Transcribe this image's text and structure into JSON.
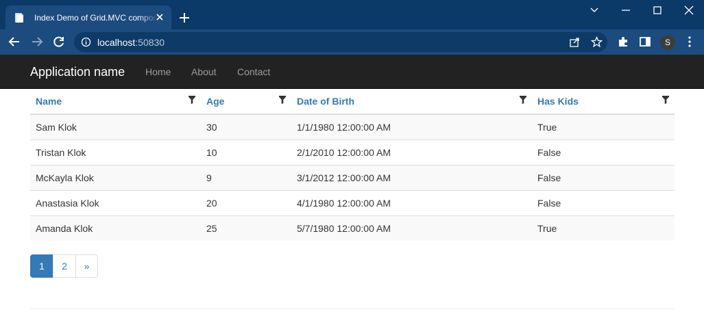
{
  "browser": {
    "tab_title": "Index Demo of Grid.MVC component",
    "url_host": "localhost",
    "url_port": ":50830",
    "profile_initial": "S"
  },
  "navbar": {
    "brand": "Application name",
    "links": [
      "Home",
      "About",
      "Contact"
    ]
  },
  "grid": {
    "columns": [
      "Name",
      "Age",
      "Date of Birth",
      "Has Kids"
    ],
    "rows": [
      [
        "Sam Klok",
        "30",
        "1/1/1980 12:00:00 AM",
        "True"
      ],
      [
        "Tristan Klok",
        "10",
        "2/1/2010 12:00:00 AM",
        "False"
      ],
      [
        "McKayla Klok",
        "9",
        "3/1/2012 12:00:00 AM",
        "False"
      ],
      [
        "Anastasia Klok",
        "20",
        "4/1/1980 12:00:00 AM",
        "False"
      ],
      [
        "Amanda Klok",
        "25",
        "5/7/1980 12:00:00 AM",
        "True"
      ]
    ]
  },
  "pager": {
    "pages": [
      "1",
      "2",
      "»"
    ],
    "active": "1"
  },
  "colors": {
    "link": "#337ab7",
    "navbar": "#222222",
    "browser_frame": "#0b3a68"
  }
}
